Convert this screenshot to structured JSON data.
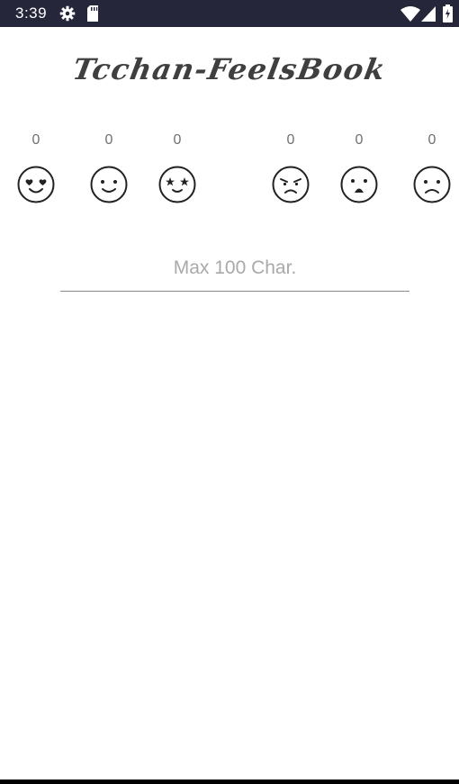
{
  "status_bar": {
    "time": "3:39",
    "icons": [
      "settings-gear-icon",
      "sd-card-icon",
      "wifi-icon",
      "cell-signal-icon",
      "battery-charging-icon"
    ],
    "background": "#26263a"
  },
  "app": {
    "title": "Tcchan-FeelsBook"
  },
  "emotions": [
    {
      "icon": "love-face-icon",
      "count": "0"
    },
    {
      "icon": "joy-face-icon",
      "count": "0"
    },
    {
      "icon": "surprise-face-icon",
      "count": "0"
    },
    {
      "icon": "anger-face-icon",
      "count": "0"
    },
    {
      "icon": "fear-face-icon",
      "count": "0"
    },
    {
      "icon": "sad-face-icon",
      "count": "0"
    }
  ],
  "comment": {
    "placeholder": "Max 100 Char.",
    "value": ""
  }
}
